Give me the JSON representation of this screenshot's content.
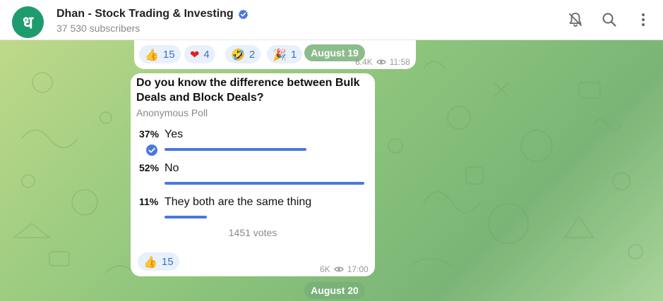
{
  "header": {
    "avatar_letter": "ध",
    "title": "Dhan - Stock Trading & Investing",
    "subscribers": "37 530 subscribers",
    "icons": [
      "verified-icon",
      "mute-bell-icon",
      "search-icon",
      "more-vertical-icon"
    ]
  },
  "prev_message": {
    "reactions": [
      {
        "emoji": "👍",
        "count": "15"
      },
      {
        "emoji": "❤",
        "count": "4"
      },
      {
        "emoji": "🤣",
        "count": "2"
      },
      {
        "emoji": "🎉",
        "count": "1"
      }
    ],
    "views": "6.4K",
    "time": "11:58"
  },
  "date_separators": [
    "August 19",
    "August 20"
  ],
  "poll": {
    "question": "Do you know the difference between Bulk Deals and Block Deals?",
    "type_label": "Anonymous Poll",
    "options": [
      {
        "percent": "37%",
        "text": "Yes",
        "fraction": 0.37,
        "chosen": true
      },
      {
        "percent": "52%",
        "text": "No",
        "fraction": 0.52,
        "chosen": false
      },
      {
        "percent": "11%",
        "text": "They both are the same thing",
        "fraction": 0.11,
        "chosen": false
      }
    ],
    "votes": "1451 votes",
    "reaction": {
      "emoji": "👍",
      "count": "15"
    },
    "views": "6K",
    "time": "17:00"
  },
  "colors": {
    "accent": "#4a78dc",
    "avatar": "#1f9c6e",
    "date_pill": "#78b078"
  }
}
